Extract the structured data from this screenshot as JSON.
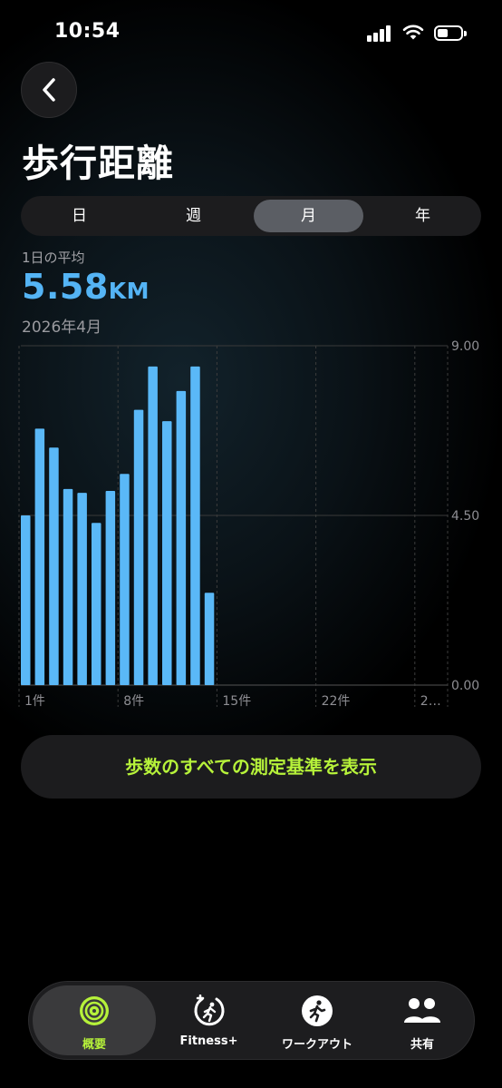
{
  "status_bar": {
    "time": "10:54"
  },
  "header": {
    "title": "歩行距離"
  },
  "segments": [
    "日",
    "週",
    "月",
    "年"
  ],
  "active_segment": "月",
  "summary": {
    "label": "1日の平均",
    "value": "5.58",
    "unit": "KM",
    "period": "2026年4月"
  },
  "chart_data": {
    "type": "bar",
    "ylim": [
      0,
      9
    ],
    "y_ticks": [
      "9.00",
      "4.50",
      "0.00"
    ],
    "x_tick_labels": [
      "1件",
      "8件",
      "15件",
      "22件",
      "2…"
    ],
    "days": [
      1,
      2,
      3,
      4,
      5,
      6,
      7,
      8,
      9,
      10,
      11,
      12,
      13,
      14
    ],
    "values": [
      4.5,
      6.8,
      6.3,
      5.2,
      5.1,
      4.3,
      5.15,
      5.6,
      7.3,
      8.45,
      7.0,
      7.8,
      8.45,
      2.45
    ],
    "bar_color": "#5ab8f7",
    "grid": true
  },
  "cta": {
    "label": "歩数のすべての測定基準を表示"
  },
  "tab_bar": {
    "items": [
      {
        "label": "概要",
        "icon": "activity-rings-icon"
      },
      {
        "label": "Fitness+",
        "icon": "fitness-plus-icon"
      },
      {
        "label": "ワークアウト",
        "icon": "running-figure-icon"
      },
      {
        "label": "共有",
        "icon": "people-icon"
      }
    ]
  },
  "colors": {
    "accent_green": "#b6f23a",
    "accent_blue": "#54b4f5"
  }
}
